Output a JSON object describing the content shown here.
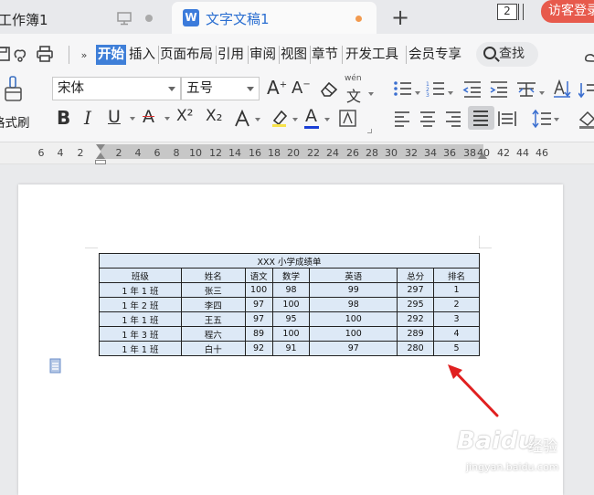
{
  "tabs": {
    "inactive_title": "工作簿1",
    "active_title": "文字文稿1",
    "doc_count": "2",
    "visitor_label": "访客登录"
  },
  "menu": {
    "items": [
      "开始",
      "插入",
      "页面布局",
      "引用",
      "审阅",
      "视图",
      "章节",
      "开发工具",
      "会员专享"
    ],
    "active": "开始",
    "search_label": "查找"
  },
  "toolbar": {
    "format_painter_label": "格式刷",
    "font_name": "宋体",
    "font_size": "五号",
    "bold": "B",
    "italic": "I",
    "underline": "U",
    "strike": "A",
    "superscript": "X²",
    "subscript": "X₂",
    "grow_font": "A⁺",
    "shrink_font": "A⁻",
    "phonetic": "wén",
    "phonetic_char": "文"
  },
  "ruler": {
    "left_numbers": [
      "6",
      "4",
      "2"
    ],
    "numbers": [
      "2",
      "4",
      "6",
      "8",
      "10",
      "12",
      "14",
      "16",
      "18",
      "20",
      "22",
      "24",
      "26",
      "28",
      "30",
      "32",
      "34",
      "36",
      "38",
      "40",
      "42",
      "44",
      "46"
    ]
  },
  "table": {
    "title": "XXX 小学成绩单",
    "headers": [
      "班级",
      "姓名",
      "语文",
      "数学",
      "英语",
      "总分",
      "排名"
    ],
    "rows": [
      [
        "1 年 1 班",
        "张三",
        "100",
        "98",
        "99",
        "297",
        "1"
      ],
      [
        "1 年 2 班",
        "李四",
        "97",
        "100",
        "98",
        "295",
        "2"
      ],
      [
        "1 年 1 班",
        "王五",
        "97",
        "95",
        "100",
        "292",
        "3"
      ],
      [
        "1 年 3 班",
        "程六",
        "89",
        "100",
        "100",
        "289",
        "4"
      ],
      [
        "1 年 1 班",
        "白十",
        "92",
        "91",
        "97",
        "280",
        "5"
      ]
    ]
  },
  "watermark": {
    "brand": "Baidu",
    "jingyan": "经验",
    "url": "jingyan.baidu.com"
  },
  "colors": {
    "accent": "#3f7fd8",
    "table_fill": "#dde9f6",
    "visitor": "#e75a4c",
    "arrow": "#e02020"
  }
}
